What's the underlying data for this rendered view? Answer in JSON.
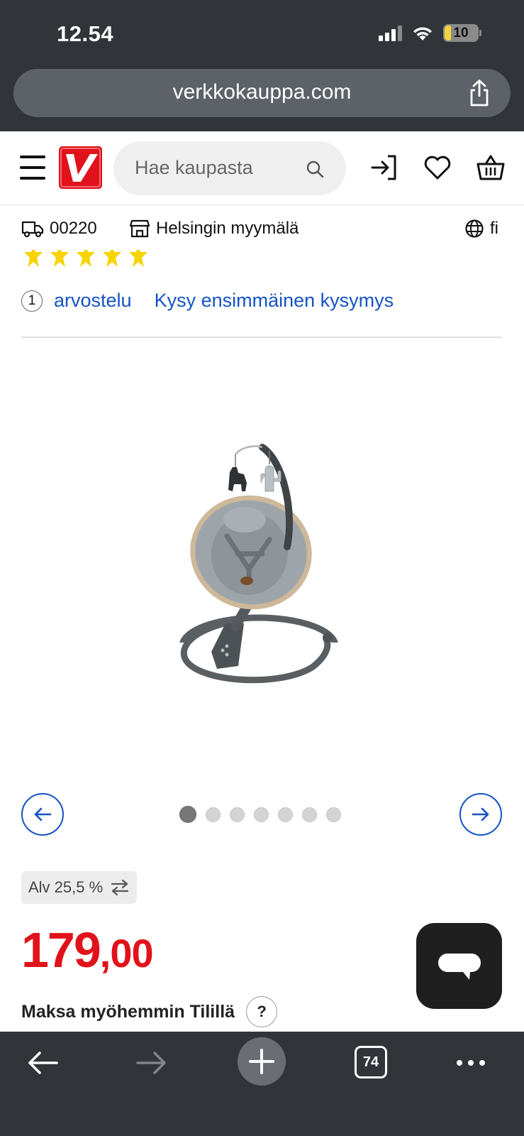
{
  "status_bar": {
    "time": "12.54",
    "battery": "10"
  },
  "browser": {
    "url": "verkkokauppa.com",
    "tab_count": "74"
  },
  "header": {
    "search_placeholder": "Hae kaupasta"
  },
  "location": {
    "postal_code": "00220",
    "store": "Helsingin myymälä",
    "language": "fi"
  },
  "rating": {
    "stars": 5,
    "review_count": "1",
    "review_label": "arvostelu",
    "question_link": "Kysy ensimmäinen kysymys"
  },
  "gallery": {
    "image_count": 7,
    "active_index": 0
  },
  "price": {
    "vat_label": "Alv 25,5 %",
    "integer": "179",
    "decimal": ",00",
    "pay_later_label": "Maksa myöhemmin Tilillä",
    "help_label": "?"
  },
  "colors": {
    "brand_red": "#e1121b",
    "link_blue": "#1553c6",
    "star_yellow": "#f7d300"
  }
}
